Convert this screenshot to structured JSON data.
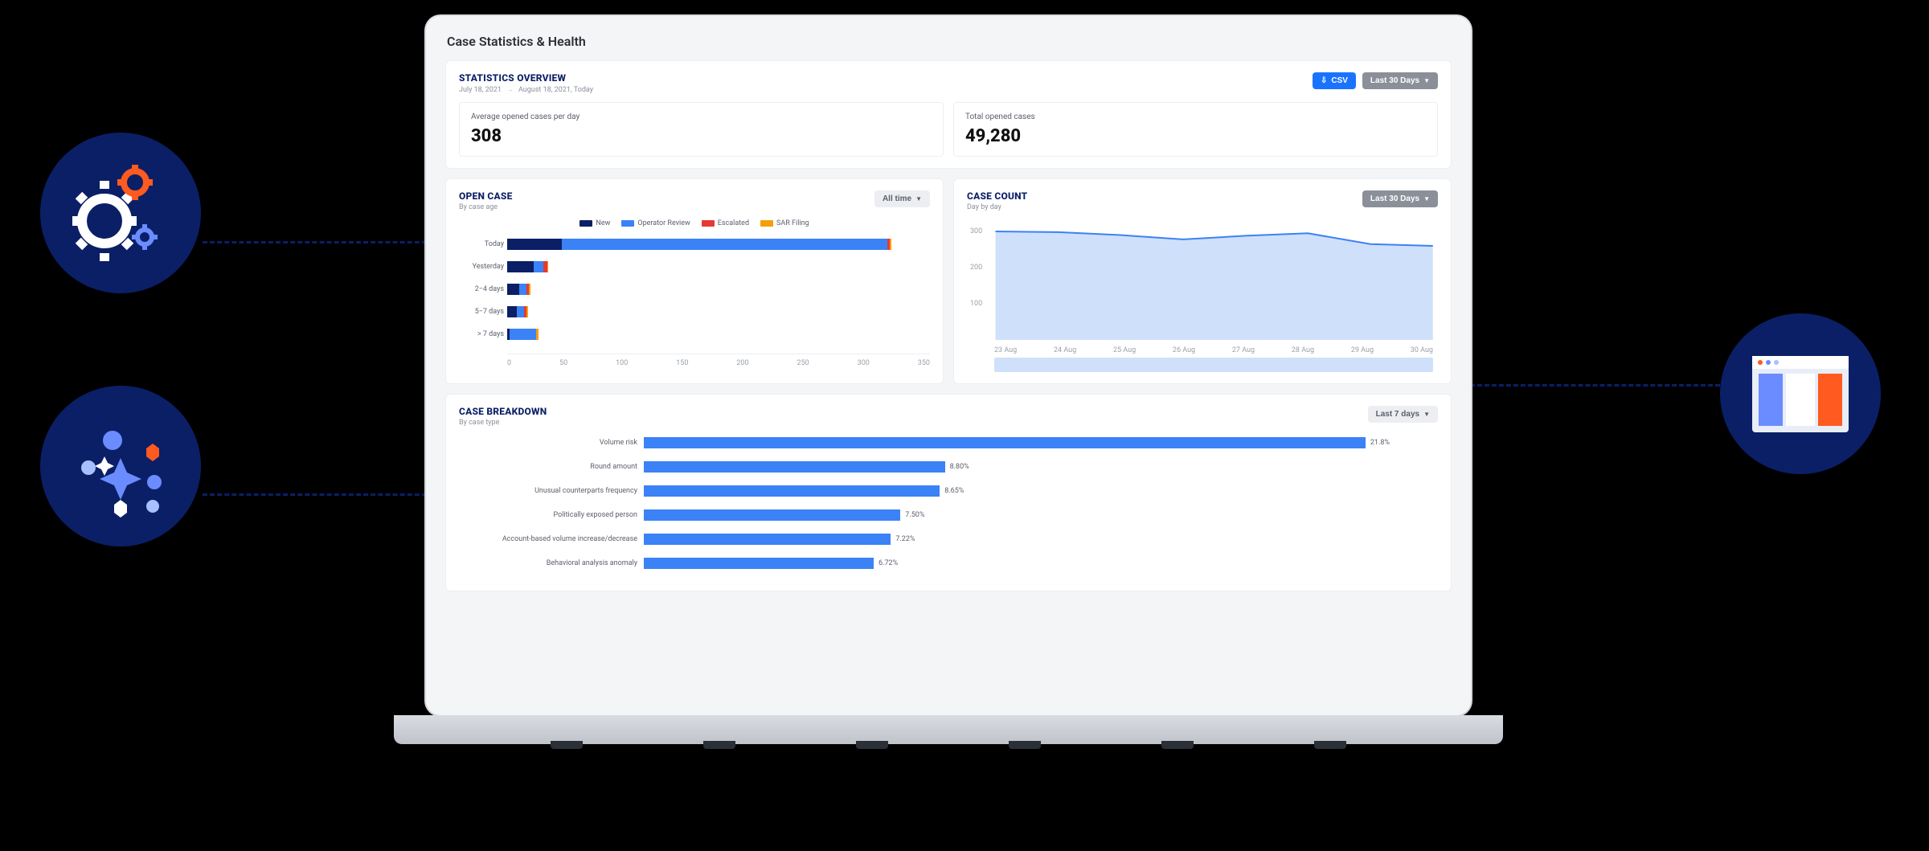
{
  "page": {
    "title": "Case Statistics & Health"
  },
  "overview": {
    "title": "STATISTICS OVERVIEW",
    "date_from": "July 18, 2021",
    "date_to": "August 18, 2021, Today",
    "csv_button": "CSV",
    "range_button": "Last 30 Days",
    "stats": [
      {
        "label": "Average opened cases per day",
        "value": "308"
      },
      {
        "label": "Total opened cases",
        "value": "49,280"
      }
    ]
  },
  "open_case": {
    "title": "OPEN CASE",
    "subtitle": "By case age",
    "range_button": "All time",
    "legend": [
      {
        "name": "New",
        "color": "#0b1f66"
      },
      {
        "name": "Operator Review",
        "color": "#3b82f6"
      },
      {
        "name": "Escalated",
        "color": "#e53935"
      },
      {
        "name": "SAR Filing",
        "color": "#f59e0b"
      }
    ]
  },
  "case_count": {
    "title": "CASE COUNT",
    "subtitle": "Day by day",
    "range_button": "Last 30 Days"
  },
  "breakdown": {
    "title": "CASE BREAKDOWN",
    "subtitle": "By case type",
    "range_button": "Last 7 days"
  },
  "chart_data": [
    {
      "id": "open_case",
      "type": "bar",
      "orientation": "horizontal",
      "stacked": true,
      "xlim": [
        0,
        350
      ],
      "xticks": [
        0,
        50,
        100,
        150,
        200,
        250,
        300,
        350
      ],
      "categories": [
        "Today",
        "Yesterday",
        "2−4 days",
        "5−7 days",
        "> 7 days"
      ],
      "series": [
        {
          "name": "New",
          "color": "#0b1f66",
          "values": [
            45,
            22,
            10,
            8,
            2
          ]
        },
        {
          "name": "Operator Review",
          "color": "#3b82f6",
          "values": [
            270,
            8,
            6,
            6,
            22
          ]
        },
        {
          "name": "Escalated",
          "color": "#e53935",
          "values": [
            2,
            3,
            2,
            2,
            0
          ]
        },
        {
          "name": "SAR Filing",
          "color": "#f59e0b",
          "values": [
            1,
            1,
            1,
            1,
            2
          ]
        }
      ]
    },
    {
      "id": "case_count",
      "type": "area",
      "x": [
        "23 Aug",
        "24 Aug",
        "25 Aug",
        "26 Aug",
        "27 Aug",
        "28 Aug",
        "29 Aug",
        "30 Aug"
      ],
      "values": [
        300,
        298,
        290,
        278,
        288,
        295,
        265,
        260
      ],
      "ylim": [
        0,
        320
      ],
      "yticks": [
        100,
        200,
        300
      ],
      "color_line": "#3b82f6",
      "color_fill": "#cfe0fb"
    },
    {
      "id": "case_breakdown",
      "type": "bar",
      "orientation": "horizontal",
      "color": "#3b82f6",
      "categories": [
        "Volume risk",
        "Round amount",
        "Unusual counterparts frequency",
        "Politically exposed person",
        "Account-based volume increase/decrease",
        "Behavioral analysis anomaly"
      ],
      "values": [
        21.8,
        8.8,
        8.65,
        7.5,
        7.22,
        6.72
      ],
      "value_labels": [
        "21.8%",
        "8.80%",
        "8.65%",
        "7.50%",
        "7.22%",
        "6.72%"
      ]
    }
  ]
}
